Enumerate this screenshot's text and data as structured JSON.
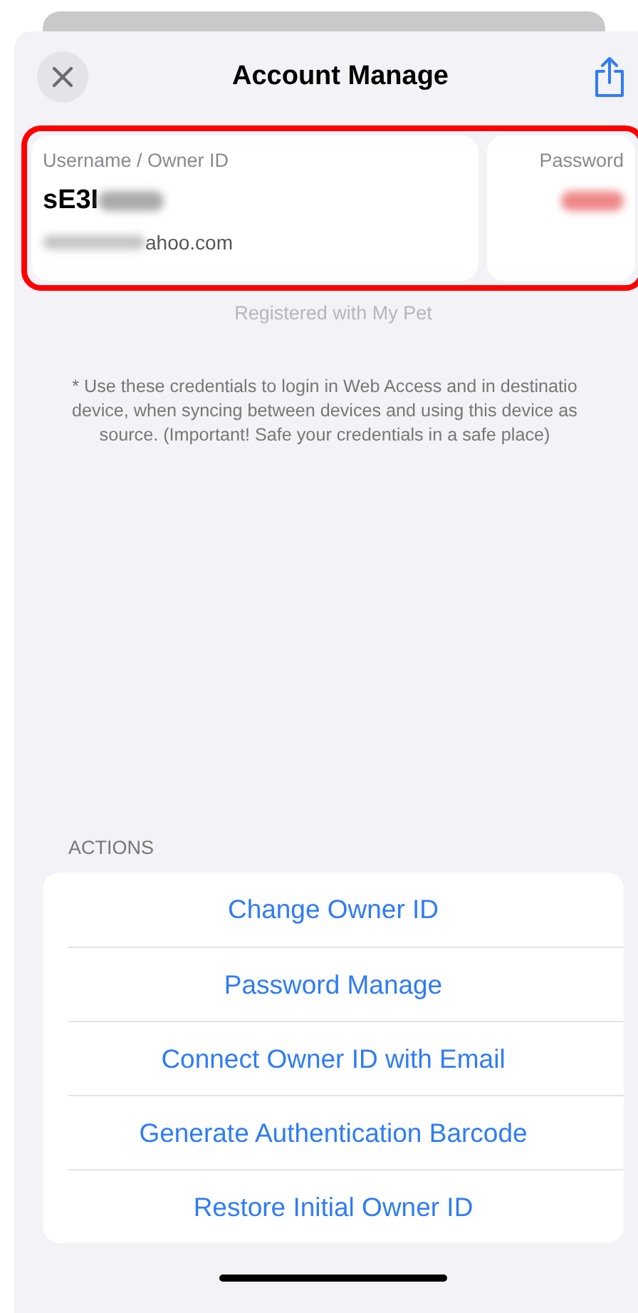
{
  "header": {
    "title": "Account Manage"
  },
  "credentials": {
    "username_label": "Username / Owner ID",
    "username": "sE3I",
    "email": "ahoo.com",
    "password_label": "Password"
  },
  "registered_note": "Registered with My Pet",
  "info_note": "* Use these credentials to login in Web Access and in destinatio\ndevice, when syncing between devices and using this device as\nsource. (Important! Safe your credentials in a safe place)",
  "actions": {
    "header": "ACTIONS",
    "items": [
      "Change Owner ID",
      "Password Manage",
      "Connect Owner ID with Email",
      "Generate Authentication Barcode",
      "Restore Initial Owner ID"
    ]
  }
}
